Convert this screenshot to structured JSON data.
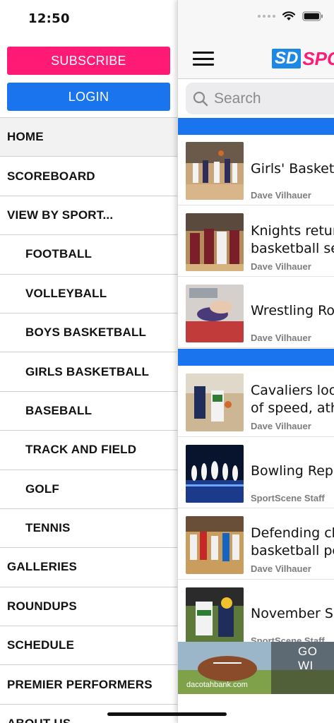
{
  "status_bar": {
    "time": "12:50"
  },
  "drawer": {
    "subscribe_label": "SUBSCRIBE",
    "login_label": "LOGIN",
    "menu": [
      {
        "label": "HOME",
        "level": "top",
        "active": true
      },
      {
        "label": "SCOREBOARD",
        "level": "top"
      },
      {
        "label": "VIEW BY SPORT...",
        "level": "top"
      },
      {
        "label": "FOOTBALL",
        "level": "sub"
      },
      {
        "label": "VOLLEYBALL",
        "level": "sub"
      },
      {
        "label": "BOYS BASKETBALL",
        "level": "sub"
      },
      {
        "label": "GIRLS BASKETBALL",
        "level": "sub"
      },
      {
        "label": "BASEBALL",
        "level": "sub"
      },
      {
        "label": "TRACK AND FIELD",
        "level": "sub"
      },
      {
        "label": "GOLF",
        "level": "sub"
      },
      {
        "label": "TENNIS",
        "level": "sub"
      },
      {
        "label": "GALLERIES",
        "level": "top"
      },
      {
        "label": "ROUNDUPS",
        "level": "top"
      },
      {
        "label": "SCHEDULE",
        "level": "top"
      },
      {
        "label": "PREMIER PERFORMERS",
        "level": "top"
      },
      {
        "label": "ABOUT US",
        "level": "top"
      }
    ]
  },
  "header": {
    "logo_box": "SD",
    "logo_text": "SPO"
  },
  "search": {
    "placeholder": "Search"
  },
  "articles": [
    {
      "title": [
        "Girls' Basketb"
      ],
      "author": "Dave Vilhauer",
      "thumb": "girls-basketball-photo"
    },
    {
      "title": [
        "Knights return",
        "basketball se"
      ],
      "author": "Dave Vilhauer",
      "thumb": "boys-basketball-photo"
    },
    {
      "title": [
        "Wrestling Rou"
      ],
      "author": "Dave Vilhauer",
      "thumb": "wrestling-photo"
    },
    {
      "title": [
        "Cavaliers lool",
        "of speed, athl"
      ],
      "author": "Dave Vilhauer",
      "thumb": "basketball-drive-photo"
    },
    {
      "title": [
        "Bowling Repo"
      ],
      "author": "SportScene Staff",
      "thumb": "bowling-pins-photo"
    },
    {
      "title": [
        "Defending ch",
        "basketball po"
      ],
      "author": "Dave Vilhauer",
      "thumb": "basketball-game-photo"
    },
    {
      "title": [
        "November Sp"
      ],
      "author": "SportScene Staff",
      "thumb": "football-photo"
    }
  ],
  "ad": {
    "url": "dacotahbank.com",
    "headline": "GO WI"
  },
  "colors": {
    "subscribe": "#ff1a75",
    "login": "#1a74ee",
    "accent_blue": "#1a74ee",
    "brand_pink": "#ff1a75"
  }
}
